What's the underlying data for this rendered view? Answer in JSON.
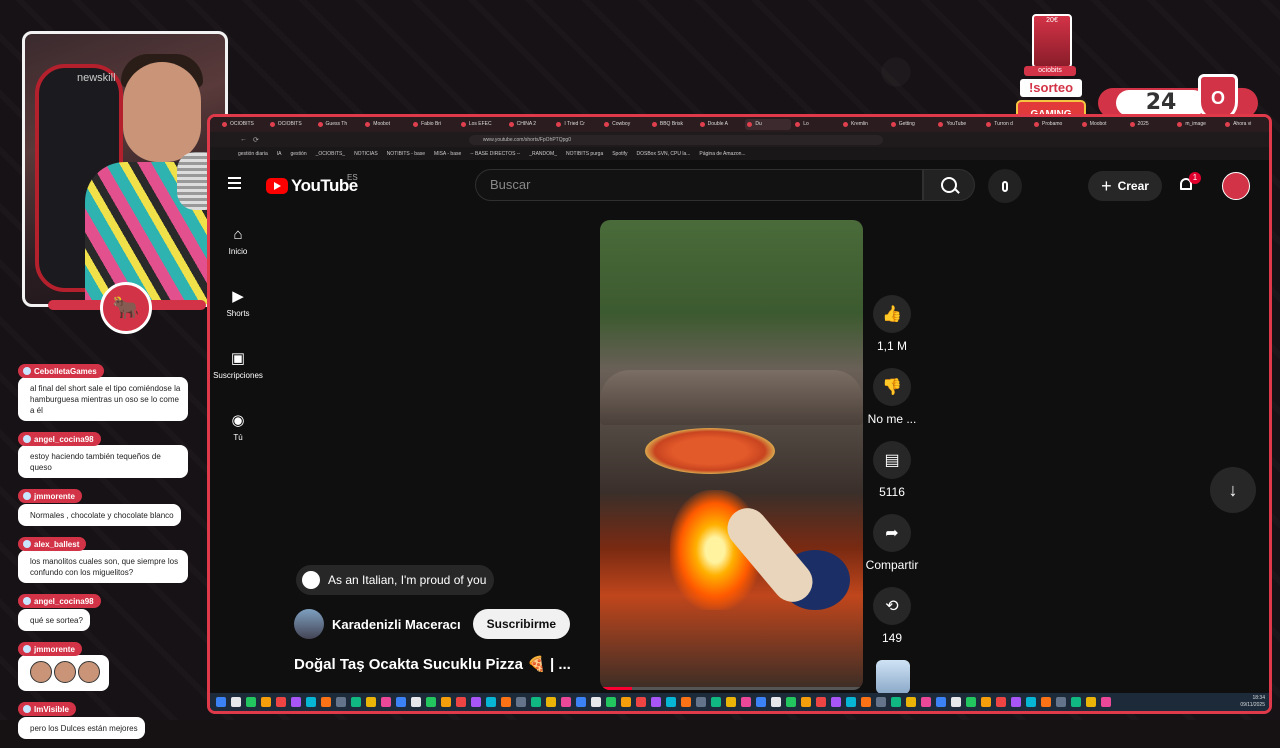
{
  "overlay": {
    "cam_brand": "newskill",
    "counter": "24",
    "sorteo": "!sorteo",
    "ociobits": "ociobits",
    "card": "20€",
    "gaming": "GAMING"
  },
  "chat": [
    {
      "user": "CebolletaGames",
      "text": "al final del short sale el tipo comiéndose la hamburguesa mientras un oso se lo come a él"
    },
    {
      "user": "angel_cocina98",
      "text": "estoy haciendo también tequeños de queso"
    },
    {
      "user": "jmmorente",
      "text": "Normales , chocolate y chocolate blanco"
    },
    {
      "user": "alex_ballest",
      "text": "los manolitos cuales son, que siempre los confundo con los miguelitos?"
    },
    {
      "user": "angel_cocina98",
      "text": "qué se sortea?"
    },
    {
      "user": "jmmorente",
      "text": ""
    },
    {
      "user": "ImVisible",
      "text": "pero los Dulces están mejores"
    }
  ],
  "browser": {
    "tabs": [
      "OCIOBITS",
      "OCIOBITS",
      "Guess Th",
      "Moobot",
      "Fabio Bri",
      "Los EFEC",
      "CHINA 2",
      "I Tried Cr",
      "Cowboy",
      "BBQ Brisk",
      "Double A",
      "Du",
      "Lo",
      "Kremlin",
      "Getting",
      "YouTube",
      "Turron d",
      "Probamo",
      "Moobot",
      "2025",
      "m_image",
      "Ahora vi"
    ],
    "url": "www.youtube.com/shorts/FpOhPTQpg0",
    "bookmarks": [
      "gestión diaria",
      "IA",
      "gestión",
      "_OCIOBITS_",
      "NOTICIAS",
      "NOTIBITS - base",
      "MISA - base",
      "-- BASE DIRECTOS --",
      "_RANDOM_",
      "NOTIBITS purga",
      "Spotify",
      "DOSBox SVN, CPU la...",
      "Página de Amazon..."
    ]
  },
  "youtube": {
    "logo": "YouTube",
    "country": "ES",
    "search_placeholder": "Buscar",
    "create_label": "Crear",
    "notif_count": "1",
    "guide": [
      {
        "label": "Inicio",
        "icon": "home-icon"
      },
      {
        "label": "Shorts",
        "icon": "shorts-icon"
      },
      {
        "label": "Suscripciones",
        "icon": "subscriptions-icon"
      },
      {
        "label": "Tú",
        "icon": "you-icon"
      }
    ],
    "actions": {
      "likes": "1,1 M",
      "dislike": "No me ...",
      "comments": "5116",
      "share": "Compartir",
      "remix": "149"
    },
    "progress": 0.12,
    "top_comment": "As an Italian, I'm proud of you",
    "channel": "Karadenizli Maceracı",
    "subscribe": "Suscribirme",
    "title": "Doğal Taş Ocakta Sucuklu Pizza 🍕 | ..."
  },
  "taskbar": {
    "time": "18:34",
    "date": "09/11/2025"
  }
}
